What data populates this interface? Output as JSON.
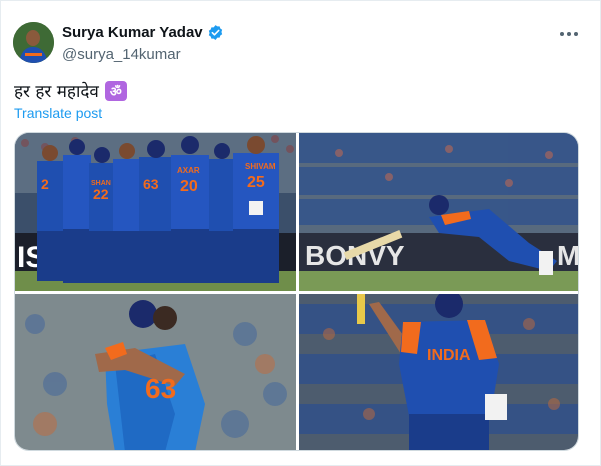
{
  "author": {
    "display_name": "Surya Kumar Yadav",
    "handle": "@surya_14kumar",
    "verified": true,
    "verified_color": "#1d9bf0"
  },
  "post": {
    "text": "हर हर महादेव",
    "emoji_badge": "ॐ",
    "translate_label": "Translate post"
  },
  "media": {
    "photo1": {
      "jersey_names": [
        "AXAR",
        "SHIVAM",
        "SHAN"
      ],
      "jersey_numbers": [
        "20",
        "25",
        "63",
        "22",
        "2"
      ],
      "board": "ISI"
    },
    "photo2": {
      "board": "BONVY",
      "board_end": "M"
    },
    "photo3": {
      "jersey_numbers": [
        "63"
      ]
    },
    "photo4": {
      "chest": "INDIA"
    }
  },
  "colors": {
    "accent": "#1d9bf0",
    "india_blue": "#1f4fb0",
    "india_orange": "#f26b1d",
    "grass": "#6f8e4a"
  }
}
